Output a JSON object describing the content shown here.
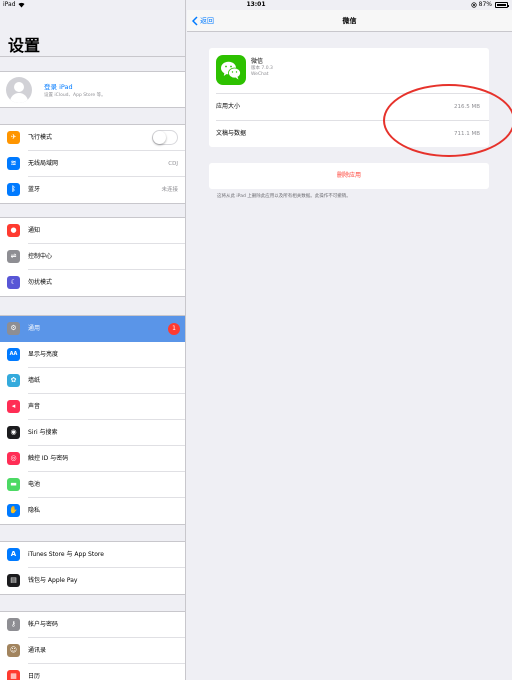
{
  "status_bar": {
    "device": "iPad",
    "time": "13:01",
    "battery_text": "87%",
    "battery_level": 0.87
  },
  "sidebar": {
    "title": "设置",
    "profile": {
      "name": "登录 iPad",
      "subtitle": "设置 iCloud、App Store 等。"
    },
    "groups": [
      [
        {
          "label": "飞行模式",
          "icon": "airplane-icon",
          "color": "#ff9500",
          "toggle": true
        },
        {
          "label": "无线局域网",
          "icon": "wifi-icon",
          "color": "#007aff",
          "value": "CDJ"
        },
        {
          "label": "蓝牙",
          "icon": "bluetooth-icon",
          "color": "#007aff",
          "value": "未连接"
        }
      ],
      [
        {
          "label": "通知",
          "icon": "notification-icon",
          "color": "#ff3b30"
        },
        {
          "label": "控制中心",
          "icon": "control-center-icon",
          "color": "#8e8e93"
        },
        {
          "label": "勿扰模式",
          "icon": "moon-icon",
          "color": "#5856d6"
        }
      ],
      [
        {
          "label": "通用",
          "icon": "gear-icon",
          "color": "#8e8e93",
          "badge": "1",
          "selected": true
        },
        {
          "label": "显示与亮度",
          "icon": "display-icon",
          "color": "#007aff"
        },
        {
          "label": "墙纸",
          "icon": "wallpaper-icon",
          "color": "#34aadc"
        },
        {
          "label": "声音",
          "icon": "speaker-icon",
          "color": "#ff2d55"
        },
        {
          "label": "Siri 与搜索",
          "icon": "siri-icon",
          "color": "#1c1c1e"
        },
        {
          "label": "触控 ID 与密码",
          "icon": "fingerprint-icon",
          "color": "#ff2d55"
        },
        {
          "label": "电池",
          "icon": "battery-icon",
          "color": "#4cd964"
        },
        {
          "label": "隐私",
          "icon": "hand-icon",
          "color": "#007aff"
        }
      ],
      [
        {
          "label": "iTunes Store 与 App Store",
          "icon": "app-store-icon",
          "color": "#007aff"
        },
        {
          "label": "钱包与 Apple Pay",
          "icon": "wallet-icon",
          "color": "#1c1c1e"
        }
      ],
      [
        {
          "label": "帐户与密码",
          "icon": "key-icon",
          "color": "#8e8e93"
        },
        {
          "label": "通讯录",
          "icon": "contacts-icon",
          "color": "#a2845e"
        },
        {
          "label": "日历",
          "icon": "calendar-icon",
          "color": "#ff3b30"
        }
      ]
    ]
  },
  "detail": {
    "back_label": "返回",
    "title": "微信",
    "app": {
      "name": "微信",
      "version": "版本 7.0.3",
      "vendor": "WeChat",
      "icon": "wechat-icon",
      "icon_color": "#2dc100"
    },
    "rows": [
      {
        "label": "应用大小",
        "value": "216.5 MB"
      },
      {
        "label": "文稿与数据",
        "value": "711.1 MB"
      }
    ],
    "delete_label": "删除应用",
    "delete_note": "这将从此 iPad 上删除此应用以及所有相关数据。此操作不可撤销。"
  },
  "annotation_color": "#e6322b"
}
